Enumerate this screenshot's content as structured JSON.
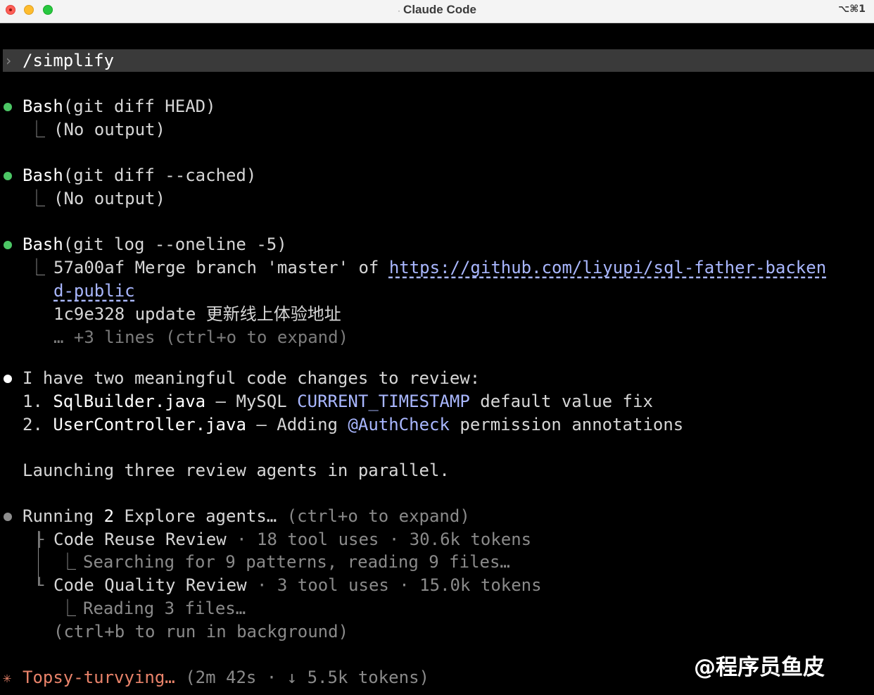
{
  "window": {
    "title": "Claude Code",
    "title_prefix": "·",
    "shortcut": "⌥⌘1"
  },
  "prompt": {
    "chevron": "›",
    "text": "/simplify"
  },
  "tool_calls": [
    {
      "name": "Bash",
      "args": "(git diff HEAD)",
      "connector": "⎿",
      "output": "(No output)"
    },
    {
      "name": "Bash",
      "args": "(git diff --cached)",
      "connector": "⎿",
      "output": "(No output)"
    },
    {
      "name": "Bash",
      "args": "(git log --oneline -5)",
      "connector": "⎿",
      "output_line1_prefix": "57a00af Merge branch 'master' of ",
      "output_link_part1": "https://github.com/liyupi/sql-father-backen",
      "output_link_part2": "d-public",
      "output_line2": "1c9e328 update 更新线上体验地址",
      "output_more": "… +3 lines (ctrl+o to expand)"
    }
  ],
  "message": {
    "intro": "I have two meaningful code changes to review:",
    "items": [
      {
        "num": "1.",
        "file": "SqlBuilder.java",
        "dash": " – ",
        "pre": "MySQL ",
        "code": "CURRENT_TIMESTAMP",
        "post": " default value fix"
      },
      {
        "num": "2.",
        "file": "UserController.java",
        "dash": " – ",
        "pre": "Adding ",
        "code": "@AuthCheck",
        "post": " permission annotations"
      }
    ],
    "launch": "Launching three review agents in parallel."
  },
  "agents": {
    "header_prefix": "Running ",
    "count": "2",
    "header_main": " Explore agents…",
    "header_hint": " (ctrl+o to expand)",
    "list": [
      {
        "name": "Code Reuse Review",
        "stats": " · 18 tool uses · 30.6k tokens",
        "status": "Searching for 9 patterns, reading 9 files…"
      },
      {
        "name": "Code Quality Review",
        "stats": " · 3 tool uses · 15.0k tokens",
        "status": "Reading 3 files…"
      }
    ],
    "background_hint": "(ctrl+b to run in background)"
  },
  "status": {
    "spinner": "✳",
    "verb": "Topsy-turvying…",
    "meta": " (2m 42s · ↓ 5.5k tokens)"
  },
  "watermark": "@程序员鱼皮",
  "colors": {
    "background": "#000000",
    "success_dot": "#4cc765",
    "link": "#a9b7ff",
    "spinner": "#e9836a"
  }
}
